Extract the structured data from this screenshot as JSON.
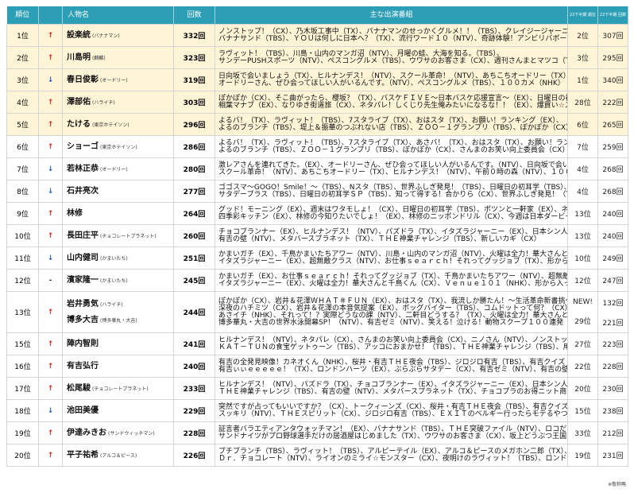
{
  "headers": {
    "rank": "順位",
    "name": "人物名",
    "count": "回数",
    "shows": "主な出演番組",
    "prev_rank": "22下半期 順位",
    "prev_count": "22下半期 回数"
  },
  "colors": {
    "header_bg": "#2c9eb5",
    "top5_bg": "#fff4d6",
    "up_arrow": "#d4261f",
    "down_arrow": "#1f5cc4"
  },
  "icons": {
    "up": "up-arrow-icon",
    "down": "down-arrow-icon",
    "same": "dash-icon"
  },
  "rows": [
    {
      "rank": "1位",
      "trend": "up",
      "arrow": "↑",
      "people": [
        {
          "name": "設楽統",
          "group": "(バナナマン)"
        }
      ],
      "count": "332回",
      "shows": [
        "ノンストップ！（CX）、乃木坂工事中（TX）、バナナマンのせっかくグルメ！！（TBS）、クレイジージャーニー（TBS）、",
        "バナナサンド（TBS）、ＹＯＵは何しに日本へ？（TX）、流行ワード１０（NTV）、奇跡体験！アンビリバボー（CX）"
      ],
      "prev_rank": "2位",
      "prev_count": "307回"
    },
    {
      "rank": "2位",
      "trend": "up",
      "arrow": "↑",
      "people": [
        {
          "name": "川島明",
          "group": "(麒麟)"
        }
      ],
      "count": "323回",
      "shows": [
        "ラヴィット！（TBS）、川島・山内のマンガ沼（NTV）、月曜の蛙、大海を知る。（TBS）、",
        "サンデーPUSHスポーツ（NTV）、ぺスコングルメ（TBS）、ウワサのお客さま（CX）、週刊さんまとマツコ（TBS）"
      ],
      "prev_rank": "3位",
      "prev_count": "295回"
    },
    {
      "rank": "3位",
      "trend": "down",
      "arrow": "↓",
      "people": [
        {
          "name": "春日俊彰",
          "group": "(オードリー)"
        }
      ],
      "count": "319回",
      "shows": [
        "日向坂で会いましょう（TX）、ヒルナンデス！（NTV）、スクール革命！（NTV）、あちこちオードリー（TX）、",
        "オードリーさん、ぜひ会ってほしい人がいるんです。（NTV）、ぺスコングルメ（TBS）、１００カメ（NHK）"
      ],
      "prev_rank": "1位",
      "prev_count": "340回"
    },
    {
      "rank": "4位",
      "trend": "up",
      "arrow": "↑",
      "people": [
        {
          "name": "澤部佑",
          "group": "(ハライチ)"
        }
      ],
      "count": "303回",
      "shows": [
        "ぽかぽか（CX）、そこ曲がったら、櫻坂？（TX）、バスケＦＩＶＥ～日本バスケ応援宣言～（EX）、日曜日の初耳学（TBS）、",
        "相葉マナブ（EX）、なりゆき街道旅（CX）、ネタパレ！しくじり先生俺みたいになるな！！（EX）、爆買い☆スター商店（EX）"
      ],
      "prev_rank": "28位",
      "prev_count": "222回"
    },
    {
      "rank": "5位",
      "trend": "up",
      "arrow": "↑",
      "people": [
        {
          "name": "たける",
          "group": "(東京ホテイソン)"
        }
      ],
      "count": "296回",
      "shows": [
        "よるバ！（TX）、ラヴィット！（TBS）、7スタライブ（TX）、おはスタ（TX）、お願い！ランキング（EX）、",
        "よるのブランチ（TBS）、堤上＆振華のつぶれない店（TBS）、ＺＯＯ－１グランプリ（TBS）、ぽかぽか（CX）"
      ],
      "prev_rank": "6位",
      "prev_count": "265回"
    },
    {
      "rank": "6位",
      "trend": "up",
      "arrow": "↑",
      "people": [
        {
          "name": "ショーゴ",
          "group": "(東京ホテイソン)"
        }
      ],
      "count": "286回",
      "shows": [
        "よるバ！（TX）、ラヴィット！（TBS）、7スタライブ（TX）、あさバ！（TX）、おはスタ（TX）、お願い！ランキング（EX）、",
        "よるのブランチ（TBS）、ＺＯＯ－１グランプリ（TBS）、ぽかぽか（CX）、さんまのお笑い向上委員会（CX）"
      ],
      "prev_rank": "7位",
      "prev_count": "259回"
    },
    {
      "rank": "7位",
      "trend": "down",
      "arrow": "↓",
      "people": [
        {
          "name": "若林正恭",
          "group": "(オードリー)"
        }
      ],
      "count": "280回",
      "shows": [
        "激レアさんを連れてきた。（EX）、オードリーさん、ぜひ会ってほしい人がいるんです。（NTV）、日向坂で会いましょう（TX）、",
        "スクール革命！（NTV）、あちこちオードリー（TX）、ヒルナンデス！（NTV）、午前０時の森（NTV）、１００カメ（NHK）"
      ],
      "prev_rank": "4位",
      "prev_count": "268回"
    },
    {
      "rank": "8位",
      "trend": "down",
      "arrow": "↓",
      "people": [
        {
          "name": "石井亮次",
          "group": ""
        }
      ],
      "count": "277回",
      "shows": [
        "ゴゴスマ～GOGO！Smile！～（TBS）、Nスタ（TBS）、世界ふしぎ発見！（TBS）、日曜日の初耳学（TBS）、",
        "サタデープラス（TBS）、日曜日の初耳学ＳＰ（TBS）、知って得する！合かりら（CX）、世界ふしぎ発見！（TBS）"
      ],
      "prev_rank": "4位",
      "prev_count": "268回"
    },
    {
      "rank": "9位",
      "trend": "up",
      "arrow": "↑",
      "people": [
        {
          "name": "林修",
          "group": ""
        }
      ],
      "count": "264回",
      "shows": [
        "グッド！モーニング（EX）、週末はワタモしょ！（CX）、日曜日の初耳学（TBS）、ポツンと一軒家（EX）、ネプリーグ（CX）、",
        "四季彩キッチン（EX）、林修の今知りたいでしょ！（EX）、林修のニッポンドリル（CX）、今週は日本ダービーでしょ！（CX）"
      ],
      "prev_rank": "13位",
      "prev_count": "240回"
    },
    {
      "rank": "10位",
      "trend": "up",
      "arrow": "↑",
      "people": [
        {
          "name": "長田庄平",
          "group": "(チョコレートプラネット)"
        }
      ],
      "count": "260回",
      "shows": [
        "チョコブランナー（EX）、ヒルナンデス！（NTV）、パズドラ（TX）、イタズラジャーニー（EX）、日本シン人機図鑑（TX）、",
        "有吉の壁（NTV）、メタバースプラネット（TX）、ＴＨＥ神業チャレンジ（TBS）、新しいカギ（CX）"
      ],
      "prev_rank": "13位",
      "prev_count": "240回"
    },
    {
      "rank": "11位",
      "trend": "down",
      "arrow": "↓",
      "people": [
        {
          "name": "山内健司",
          "group": "(かまいたち)"
        }
      ],
      "count": "251回",
      "shows": [
        "かまいガチ（EX）、千鳥かまいたちアワー（NTV）、川島・山内のマンガ沼（NTV）、火曜は全力！華大さんと千鳥くん（CX）、",
        "イタズラジャーニー（EX）、超無敵クラス（NTV）、お仕事ｓｅａｒｃｈ！それってグッジョブ（TX）、形から入ってみた（TBS）"
      ],
      "prev_rank": "10位",
      "prev_count": "249回"
    },
    {
      "rank": "12位",
      "trend": "same",
      "arrow": "-",
      "people": [
        {
          "name": "濱家隆一",
          "group": "(かまいたち)"
        }
      ],
      "count": "245回",
      "shows": [
        "かまいガチ（EX）、お仕事ｓｅａｒｃｈ！それってグッジョブ（TX）、千鳥かまいたちアワー（NTV）、超無敵クラス（NTV）、",
        "イタズラジャーニー（EX）、火曜は全力！華大さんと千鳥くん（CX）、Ｖｅｎｕｅ１０１（NHK）、形から入ってみた（TBS）"
      ],
      "prev_rank": "12位",
      "prev_count": "247回"
    },
    {
      "rank": "13位",
      "trend": "up",
      "arrow": "↑",
      "people": [
        {
          "name": "岩井勇気",
          "group": "(ハライチ)"
        },
        {
          "name": "博多大吉",
          "group": "(博多華丸・大吉)"
        }
      ],
      "count": "244回",
      "shows": [
        "ぽかぽか（CX）、岩井＆花澤ＷＨＡＴ＃ＦＵＮ（EX）、おはスタ（TX）、我流しか勝たん！～生活革命新書挑～（CX）、",
        "深夜のハチミツ（CX）、岩井＆花澤の本音気提案（EX）、ボッグバイター（TBS）、コムドットって何？（CX）、カマシ隊（TX）",
        "あさイチ（NHK）、それって！？実際どうなの課（NTV）、二軒目どうする？（TX）、火曜は全力！華大さんと千鳥くん（CX）、",
        "博多華丸・大吉の世界水泳開幕SP！（NTV）、有吉ゼミ（NTV）、笑える！泣ける！動物スクープ１００連発（TBS）"
      ],
      "prev_rank": "NEW!",
      "prev_count": "132回",
      "prev_rank2": "29位",
      "prev_count2": "221回"
    },
    {
      "rank": "15位",
      "trend": "up",
      "arrow": "↑",
      "people": [
        {
          "name": "陣内智則",
          "group": ""
        }
      ],
      "count": "241回",
      "shows": [
        "ヒルナンデス！（NTV）、ネタパレ（CX）、さんまのお笑い向上委員会（CX）、ニノさん（NTV）、ノンストップ！（CX）、",
        "ＫＡＴ－ＴＵＮの食宝ゲットゥーン（TBS）、アッコにおまかせ！（TBS）、ＴＨＥ神業チャレンジ（TBS）、用ＪＡＰＡＮ（CX）"
      ],
      "prev_rank": "27位",
      "prev_count": "223回"
    },
    {
      "rank": "16位",
      "trend": "up",
      "arrow": "↑",
      "people": [
        {
          "name": "有吉弘行",
          "group": ""
        }
      ],
      "count": "240回",
      "shows": [
        "有吉の全発見映像！カネオくん（NHK）、桜井・有吉ＴＨＥ夜会（TBS）、ジロジロ有吉（TBS）、有吉クイズ（EX）、",
        "有吉ぃぃｅｅｅｅｅ！（TX）、ロンドンハーツ（EX）、ぶらぶらサタデー（CX）、有吉ゼミ（NTV）、有吉の壁（NTV）"
      ],
      "prev_rank": "22位",
      "prev_count": "228回"
    },
    {
      "rank": "17位",
      "trend": "up",
      "arrow": "↑",
      "people": [
        {
          "name": "松尾駿",
          "group": "(チョコレートプラネット)"
        }
      ],
      "count": "233回",
      "shows": [
        "ヒルナンデス！（NTV）、パズドラ（TX）、チョコブランナー（EX）、イタズラジャーニー（EX）、日本シン人機図鑑（TX）、",
        "ＴＨＥ神業チャレンジ（TBS）、有吉の壁（NTV）、メタバースプラネット（TX）、チョコプラのお得ニット商品研究所（TBS）"
      ],
      "prev_rank": "20位",
      "prev_count": "230回"
    },
    {
      "rank": "18位",
      "trend": "down",
      "arrow": "↓",
      "people": [
        {
          "name": "池田美優",
          "group": ""
        }
      ],
      "count": "229回",
      "shows": [
        "突然ですが占ってもいいですか？（CX）、トークィーンズ（CX）、桜井・有吉ＴＨＥ夜会（TBS）、有吉クイズ（EX）、",
        "スッキリ（NTV）、ＴＨＥスピリット（CX）、ジロジロ有吉（TBS）、ＥＸＩＴのベルギー行ったらモテるやつ（TX）"
      ],
      "prev_rank": "15位",
      "prev_count": "238回"
    },
    {
      "rank": "19位",
      "trend": "up",
      "arrow": "↑",
      "people": [
        {
          "name": "伊達みきお",
          "group": "(サンドウィッチマン)"
        }
      ],
      "count": "228回",
      "shows": [
        "証言者バラエティアンタウォッチマン！（EX）、バナナサンド（TBS）、ＴＨＥ突破ファイル（NTV）、ロコだけが知っている（NHK）、",
        "サンドナイツがプロ野球選手だけの居酒屋はじめました（TX）、ウワサのお客さま（CX）、坂上どうぶつ王国（CX）"
      ],
      "prev_rank": "33位",
      "prev_count": "212回"
    },
    {
      "rank": "20位",
      "trend": "up",
      "arrow": "↑",
      "people": [
        {
          "name": "平子祐希",
          "group": "(アルコ＆ピース)"
        }
      ],
      "count": "226回",
      "shows": [
        "ブチブランチ（TBS）、ラヴィット！（TBS）、アルピーテイル（EX）、アルコ＆ピースのメガホン二郎（TX）、",
        "Ｄｒ．チョコレート（NTV）、ライオンのミライ☆モンスター（CX）、夜明けのラヴィット！（TBS）、ロンドンハーツ（EX）"
      ],
      "prev_rank": "19位",
      "prev_count": "231回"
    }
  ],
  "footnote": "※敬称略"
}
